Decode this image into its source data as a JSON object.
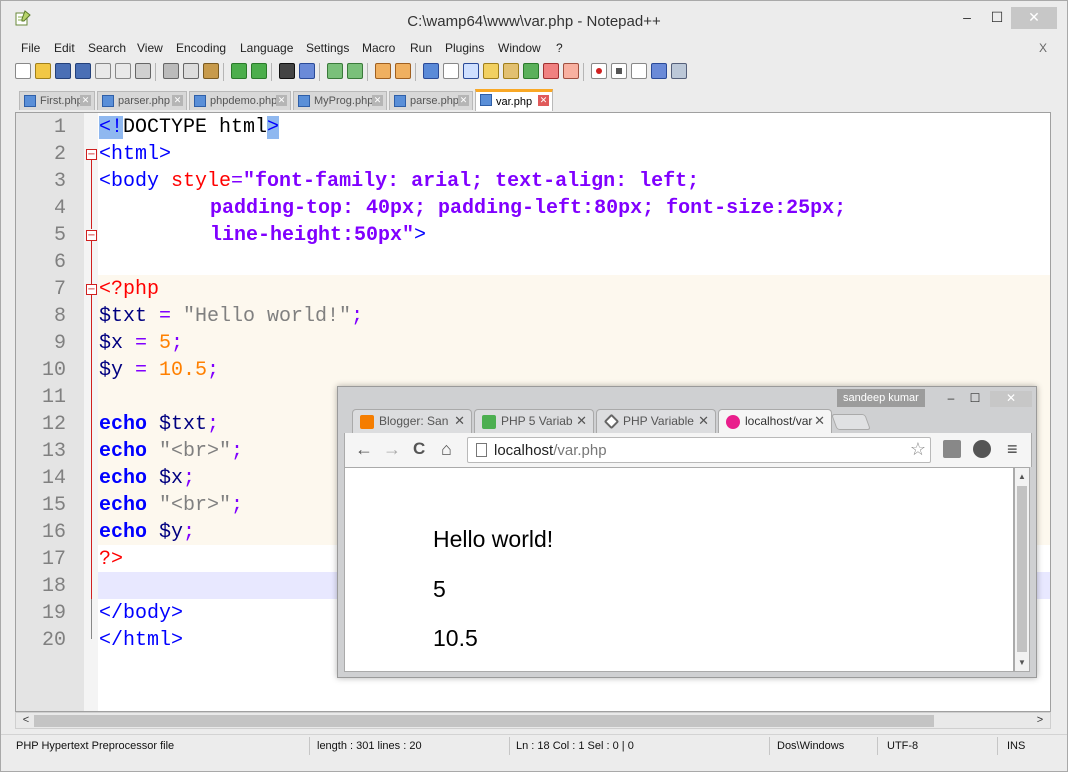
{
  "window": {
    "title": "C:\\wamp64\\www\\var.php - Notepad++",
    "min": "–",
    "max": "☐",
    "close": "✕"
  },
  "menu": [
    "File",
    "Edit",
    "Search",
    "View",
    "Encoding",
    "Language",
    "Settings",
    "Macro",
    "Run",
    "Plugins",
    "Window",
    "?"
  ],
  "menu_close": "X",
  "tabs": [
    {
      "label": "First.php",
      "active": false
    },
    {
      "label": "parser.php",
      "active": false
    },
    {
      "label": "phpdemo.php",
      "active": false
    },
    {
      "label": "MyProg.php",
      "active": false
    },
    {
      "label": "parse.php",
      "active": false
    },
    {
      "label": "var.php",
      "active": true
    }
  ],
  "tab_close": "✕",
  "editor": {
    "line_numbers": [
      "1",
      "2",
      "3",
      "4",
      "5",
      "6",
      "7",
      "8",
      "9",
      "10",
      "11",
      "12",
      "13",
      "14",
      "15",
      "16",
      "17",
      "18",
      "19",
      "20"
    ],
    "lines": {
      "l1": {
        "open": "<!",
        "rest": "DOCTYPE html",
        "close": ">"
      },
      "l2": {
        "tag": "<html>"
      },
      "l3": {
        "tag": "<body ",
        "attr": "style",
        "eq": "=",
        "str": "\"font-family: arial; text-align: left;"
      },
      "l4": {
        "str": "padding-top: 40px; padding-left:80px; font-size:25px;"
      },
      "l5": {
        "str": "line-height:50px\"",
        "tag": ">"
      },
      "l7": {
        "php": "<?php"
      },
      "l8": {
        "var": "$txt",
        "op": " = ",
        "str": "\"Hello world!\"",
        "end": ";"
      },
      "l9": {
        "var": "$x",
        "op": " = ",
        "num": "5",
        "end": ";"
      },
      "l10": {
        "var": "$y",
        "op": " = ",
        "num": "10.5",
        "end": ";"
      },
      "l12": {
        "kw": "echo",
        "var": " $txt",
        "end": ";"
      },
      "l13": {
        "kw": "echo",
        "str": " \"<br>\"",
        "end": ";"
      },
      "l14": {
        "kw": "echo",
        "var": " $x",
        "end": ";"
      },
      "l15": {
        "kw": "echo",
        "str": " \"<br>\"",
        "end": ";"
      },
      "l16": {
        "kw": "echo",
        "var": " $y",
        "end": ";"
      },
      "l17": {
        "php": "?>"
      },
      "l19": {
        "tag": "</body>"
      },
      "l20": {
        "tag": "</html>"
      }
    },
    "fold_minus": "−"
  },
  "hscroll": {
    "left": "<",
    "right": ">"
  },
  "status": {
    "filetype": "PHP Hypertext Preprocessor file",
    "length": "length : 301    lines : 20",
    "position": "Ln : 18    Col : 1    Sel : 0 | 0",
    "eol": "Dos\\Windows",
    "encoding": "UTF-8",
    "mode": "INS"
  },
  "browser": {
    "user": "sandeep kumar",
    "min": "–",
    "max": "☐",
    "close": "✕",
    "tabs": [
      {
        "label": "Blogger: San",
        "icon_color": "#f57d00",
        "active": false
      },
      {
        "label": "PHP 5 Variab",
        "icon_color": "#4caf50",
        "active": false
      },
      {
        "label": "PHP Variable",
        "icon_color": "#666666",
        "active": false
      },
      {
        "label": "localhost/var",
        "icon_color": "#e91e8c",
        "active": true
      }
    ],
    "tab_close": "✕",
    "nav": {
      "back": "←",
      "forward": "→",
      "reload": "C",
      "home": "⌂"
    },
    "url_host": "localhost",
    "url_path": "/var.php",
    "star": "☆",
    "menu": "≡",
    "page": [
      "Hello world!",
      "5",
      "10.5"
    ],
    "scroll_up": "▲",
    "scroll_down": "▼"
  },
  "colors": {
    "accent_tab": "#f9a825",
    "keyword": "#0000ff",
    "string": "#8000ff",
    "number": "#ff8000",
    "php_tag": "#ff0000"
  }
}
